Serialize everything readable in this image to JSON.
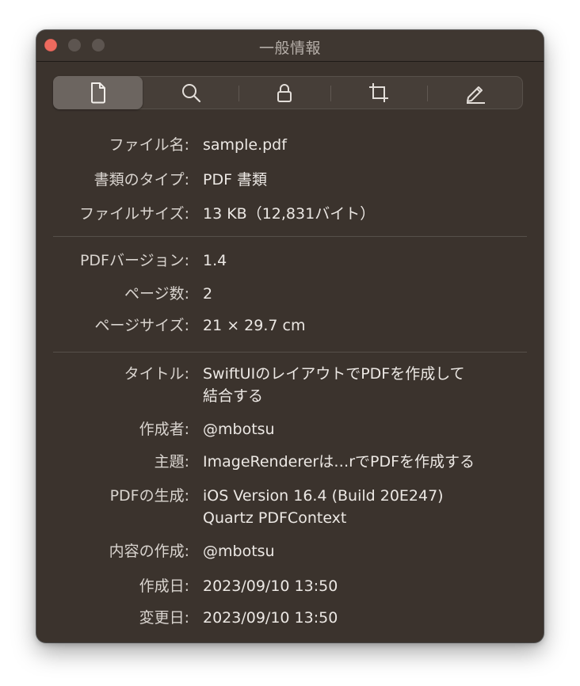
{
  "window": {
    "title": "一般情報"
  },
  "toolbar": {
    "tabs": [
      {
        "name": "document-icon",
        "active": true
      },
      {
        "name": "search-icon",
        "active": false
      },
      {
        "name": "lock-icon",
        "active": false
      },
      {
        "name": "crop-icon",
        "active": false
      },
      {
        "name": "pencil-icon",
        "active": false
      }
    ]
  },
  "info": {
    "file_name": {
      "label": "ファイル名:",
      "value": "sample.pdf"
    },
    "doc_type": {
      "label": "書類のタイプ:",
      "value": "PDF 書類"
    },
    "file_size": {
      "label": "ファイルサイズ:",
      "value": "13 KB（12,831バイト）"
    },
    "pdf_version": {
      "label": "PDFバージョン:",
      "value": "1.4"
    },
    "page_count": {
      "label": "ページ数:",
      "value": "2"
    },
    "page_size": {
      "label": "ページサイズ:",
      "value": "21 × 29.7 cm"
    },
    "title": {
      "label": "タイトル:",
      "value_line1": "SwiftUIのレイアウトでPDFを作成して",
      "value_line2": "結合する"
    },
    "author": {
      "label": "作成者:",
      "value": "@mbotsu"
    },
    "subject": {
      "label": "主題:",
      "value": "ImageRendererは…rでPDFを作成する"
    },
    "producer": {
      "label": "PDFの生成:",
      "value_line1": "iOS Version 16.4 (Build 20E247)",
      "value_line2": "Quartz PDFContext"
    },
    "creator": {
      "label": "内容の作成:",
      "value": "@mbotsu"
    },
    "created": {
      "label": "作成日:",
      "value": "2023/09/10 13:50"
    },
    "modified": {
      "label": "変更日:",
      "value": "2023/09/10 13:50"
    }
  },
  "colors": {
    "window_bg": "#3b332d",
    "close_button": "#ed6a5e",
    "label_text": "#d9d4cf",
    "value_text": "#ece8e4"
  }
}
